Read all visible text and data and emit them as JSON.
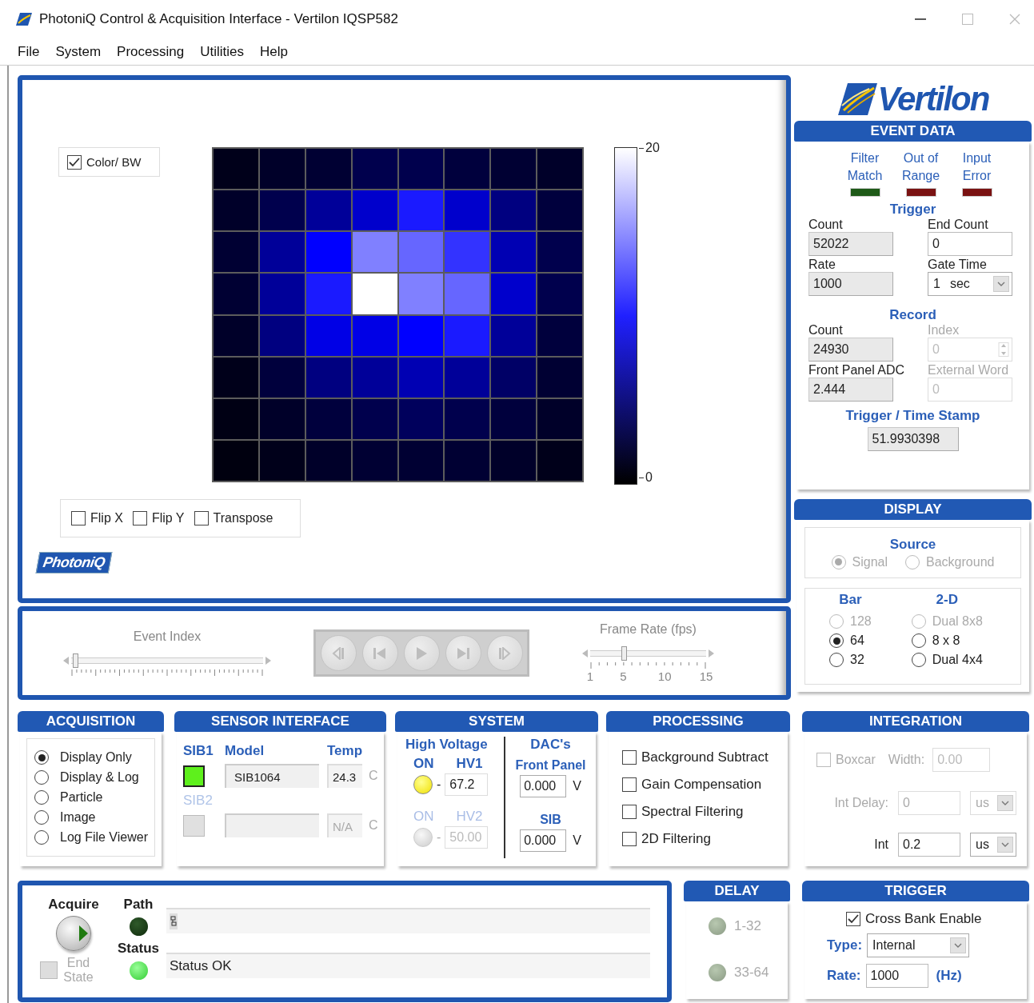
{
  "window": {
    "title": "PhotoniQ Control & Acquisition Interface - Vertilon IQSP582"
  },
  "menu": [
    "File",
    "System",
    "Processing",
    "Utilities",
    "Help"
  ],
  "image_view": {
    "color_bw": {
      "label": "Color/ BW",
      "checked": true
    },
    "scale_max": "20",
    "scale_min": "0",
    "flips": [
      {
        "label": "Flip X",
        "checked": false
      },
      {
        "label": "Flip Y",
        "checked": false
      },
      {
        "label": "Transpose",
        "checked": false
      }
    ],
    "logo": "PhotoniQ"
  },
  "playback": {
    "event_index": {
      "label": "Event Index",
      "level": 0.02
    },
    "buttons": [
      {
        "kind": "step_back",
        "disabled": true
      },
      {
        "kind": "first",
        "disabled": true
      },
      {
        "kind": "play",
        "disabled": true
      },
      {
        "kind": "last",
        "disabled": true
      },
      {
        "kind": "step_forward",
        "disabled": true
      }
    ],
    "frame_rate": {
      "label": "Frame Rate (fps)",
      "level": 0.29,
      "ticks": [
        "1",
        "5",
        "10",
        "15"
      ]
    }
  },
  "logo": "Vertilon",
  "event_data": {
    "title": "EVENT DATA",
    "flags": [
      {
        "label": "Filter Match",
        "color": "#1e5a18"
      },
      {
        "label": "Out of Range",
        "color": "#7a1212"
      },
      {
        "label": "Input Error",
        "color": "#7a1212"
      }
    ],
    "trigger": {
      "heading": "Trigger",
      "fields": [
        {
          "label": "Count",
          "value": "52022",
          "kind": "indicator",
          "disabled": false
        },
        {
          "label": "End Count",
          "value": "0",
          "kind": "input",
          "disabled": false
        },
        {
          "label": "Rate",
          "value": "1000",
          "kind": "indicator",
          "disabled": false
        },
        {
          "label": "Gate Time",
          "value": "1",
          "unit": "sec",
          "kind": "select",
          "disabled": false
        }
      ]
    },
    "record": {
      "heading": "Record",
      "fields": [
        {
          "label": "Count",
          "value": "24930",
          "kind": "indicator",
          "disabled": false
        },
        {
          "label": "Index",
          "value": "0",
          "kind": "spinner",
          "disabled": true
        },
        {
          "label": "Front Panel ADC",
          "value": "2.444",
          "kind": "indicator",
          "disabled": false
        },
        {
          "label": "External Word",
          "value": "0",
          "kind": "input",
          "disabled": true
        }
      ]
    },
    "timestamp": {
      "label": "Trigger / Time Stamp",
      "value": "51.9930398"
    }
  },
  "display": {
    "title": "DISPLAY",
    "source": {
      "heading": "Source",
      "options": [
        {
          "label": "Signal",
          "selected": true,
          "disabled": true
        },
        {
          "label": "Background",
          "selected": false,
          "disabled": true
        }
      ]
    },
    "bar": {
      "heading": "Bar",
      "options": [
        {
          "label": "128",
          "selected": false,
          "disabled": true
        },
        {
          "label": "64",
          "selected": true,
          "disabled": false
        },
        {
          "label": "32",
          "selected": false,
          "disabled": false
        }
      ]
    },
    "two_d": {
      "heading": "2-D",
      "options": [
        {
          "label": "Dual 8x8",
          "selected": false,
          "disabled": true
        },
        {
          "label": "8 x 8",
          "selected": false,
          "disabled": false
        },
        {
          "label": "Dual 4x4",
          "selected": false,
          "disabled": false
        }
      ]
    }
  },
  "acquisition": {
    "title": "ACQUISITION",
    "modes": [
      {
        "label": "Display Only",
        "selected": true
      },
      {
        "label": "Display & Log",
        "selected": false
      },
      {
        "label": "Particle",
        "selected": false
      },
      {
        "label": "Image",
        "selected": false
      },
      {
        "label": "Log File Viewer",
        "selected": false
      }
    ]
  },
  "sensor_interface": {
    "title": "SENSOR INTERFACE",
    "headers": [
      "Model",
      "Temp"
    ],
    "boards": [
      {
        "label": "SIB1",
        "on": true,
        "disabled": false,
        "model": "SIB1064",
        "temp": "24.3",
        "unit": "C"
      },
      {
        "label": "SIB2",
        "on": false,
        "disabled": true,
        "temp": "N/A",
        "unit": "C"
      }
    ]
  },
  "system": {
    "title": "SYSTEM",
    "hv_heading": "High Voltage",
    "dac_heading": "DAC's",
    "channels": [
      {
        "on_label": "ON",
        "label": "HV1",
        "on": true,
        "disabled": false,
        "dash": "-",
        "value": "67.2"
      },
      {
        "on_label": "ON",
        "label": "HV2",
        "on": false,
        "disabled": true,
        "dash": "-",
        "value": "50.00"
      }
    ],
    "dacs": [
      {
        "label": "Front Panel",
        "value": "0.000",
        "unit": "V"
      },
      {
        "label": "SIB",
        "value": "0.000",
        "unit": "V"
      }
    ]
  },
  "processing": {
    "title": "PROCESSING",
    "options": [
      {
        "label": "Background Subtract",
        "checked": false
      },
      {
        "label": "Gain Compensation",
        "checked": false
      },
      {
        "label": "Spectral Filtering",
        "checked": false
      },
      {
        "label": "2D Filtering",
        "checked": false
      }
    ]
  },
  "integration": {
    "title": "INTEGRATION",
    "boxcar": {
      "label": "Boxcar",
      "checked": false,
      "disabled": true
    },
    "rows": [
      {
        "label": "Width:",
        "value": "0.00",
        "disabled": true
      },
      {
        "label": "Int Delay:",
        "value": "0",
        "unit": "us",
        "disabled": true
      },
      {
        "label": "Int",
        "value": "0.2",
        "unit": "us",
        "disabled": false
      }
    ]
  },
  "acquire_panel": {
    "acquire_label": "Acquire",
    "end_state": {
      "label": "End State",
      "checked": false,
      "disabled": true
    },
    "path": {
      "label": "Path",
      "on": false
    },
    "status": {
      "label": "Status",
      "on": true,
      "value": "Status OK"
    }
  },
  "delay": {
    "title": "DELAY",
    "banks": [
      {
        "label": "1-32"
      },
      {
        "label": "33-64"
      }
    ]
  },
  "trigger": {
    "title": "TRIGGER",
    "cross_bank": {
      "label": "Cross Bank Enable",
      "checked": true
    },
    "type": {
      "label": "Type:",
      "value": "Internal"
    },
    "rate": {
      "label": "Rate:",
      "value": "1000",
      "unit": "(Hz)"
    }
  }
}
